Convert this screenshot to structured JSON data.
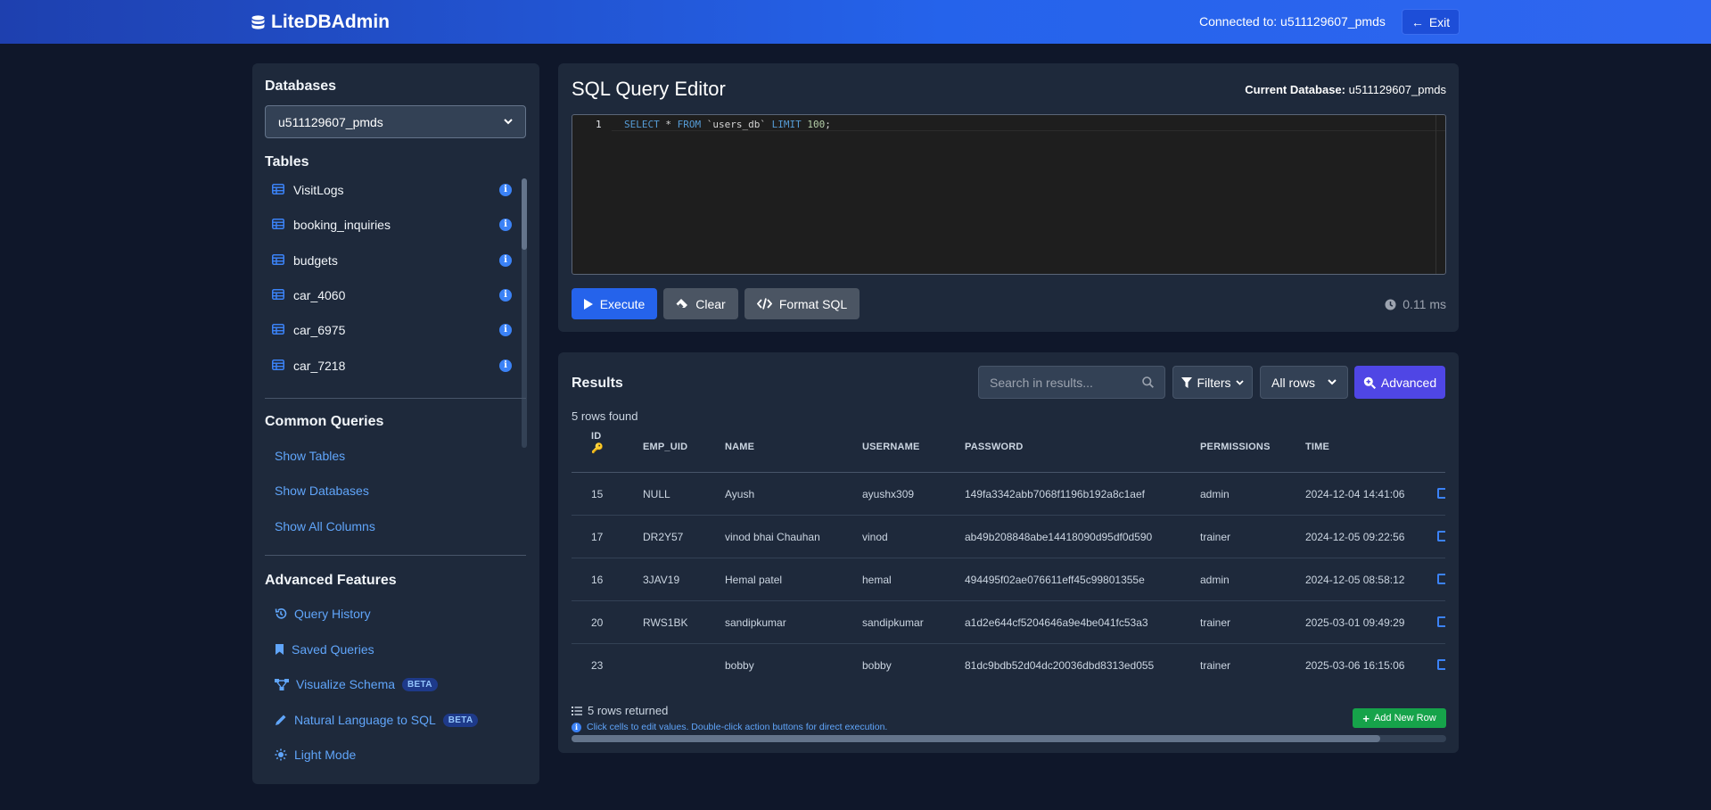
{
  "app": {
    "brand": "LiteDBAdmin",
    "connected_label": "Connected to: u511129607_pmds",
    "exit_label": "Exit"
  },
  "sidebar": {
    "databases_heading": "Databases",
    "selected_database": "u511129607_pmds",
    "tables_heading": "Tables",
    "tables": [
      "VisitLogs",
      "booking_inquiries",
      "budgets",
      "car_4060",
      "car_6975",
      "car_7218"
    ],
    "common_heading": "Common Queries",
    "common": [
      "Show Tables",
      "Show Databases",
      "Show All Columns"
    ],
    "advanced_heading": "Advanced Features",
    "advanced": [
      {
        "label": "Query History",
        "icon": "history-icon"
      },
      {
        "label": "Saved Queries",
        "icon": "bookmark-icon"
      },
      {
        "label": "Visualize Schema",
        "icon": "schema-icon",
        "badge": "BETA"
      },
      {
        "label": "Natural Language to SQL",
        "icon": "pencil-icon",
        "badge": "BETA"
      },
      {
        "label": "Light Mode",
        "icon": "sun-icon"
      }
    ]
  },
  "editor": {
    "title": "SQL Query Editor",
    "current_db_label": "Current Database:",
    "current_db": "u511129607_pmds",
    "line_number": "1",
    "query": "SELECT * FROM `users_db` LIMIT 100;",
    "execute_label": "Execute",
    "clear_label": "Clear",
    "format_label": "Format SQL",
    "timing": "0.11 ms"
  },
  "results": {
    "title": "Results",
    "search_placeholder": "Search in results...",
    "filters_label": "Filters",
    "rows_select": "All rows",
    "advanced_label": "Advanced",
    "rows_found": "5 rows found",
    "columns": [
      "ID",
      "EMP_UID",
      "NAME",
      "USERNAME",
      "PASSWORD",
      "PERMISSIONS",
      "TIME"
    ],
    "rows": [
      [
        "15",
        "NULL",
        "Ayush",
        "ayushx309",
        "149fa3342abb7068f1196b192a8c1aef",
        "admin",
        "2024-12-04 14:41:06"
      ],
      [
        "17",
        "DR2Y57",
        "vinod bhai Chauhan",
        "vinod",
        "ab49b208848abe14418090d95df0d590",
        "trainer",
        "2024-12-05 09:22:56"
      ],
      [
        "16",
        "3JAV19",
        "Hemal patel",
        "hemal",
        "494495f02ae076611eff45c99801355e",
        "admin",
        "2024-12-05 08:58:12"
      ],
      [
        "20",
        "RWS1BK",
        "sandipkumar",
        "sandipkumar",
        "a1d2e644cf5204646a9e4be041fc53a3",
        "trainer",
        "2025-03-01 09:49:29"
      ],
      [
        "23",
        "",
        "bobby",
        "bobby",
        "81dc9bdb52d04dc20036dbd8313ed055",
        "trainer",
        "2025-03-06 16:15:06"
      ]
    ],
    "rows_returned": "5 rows returned",
    "hint": "Click cells to edit values. Double-click action buttons for direct execution.",
    "add_row_label": "Add New Row"
  }
}
